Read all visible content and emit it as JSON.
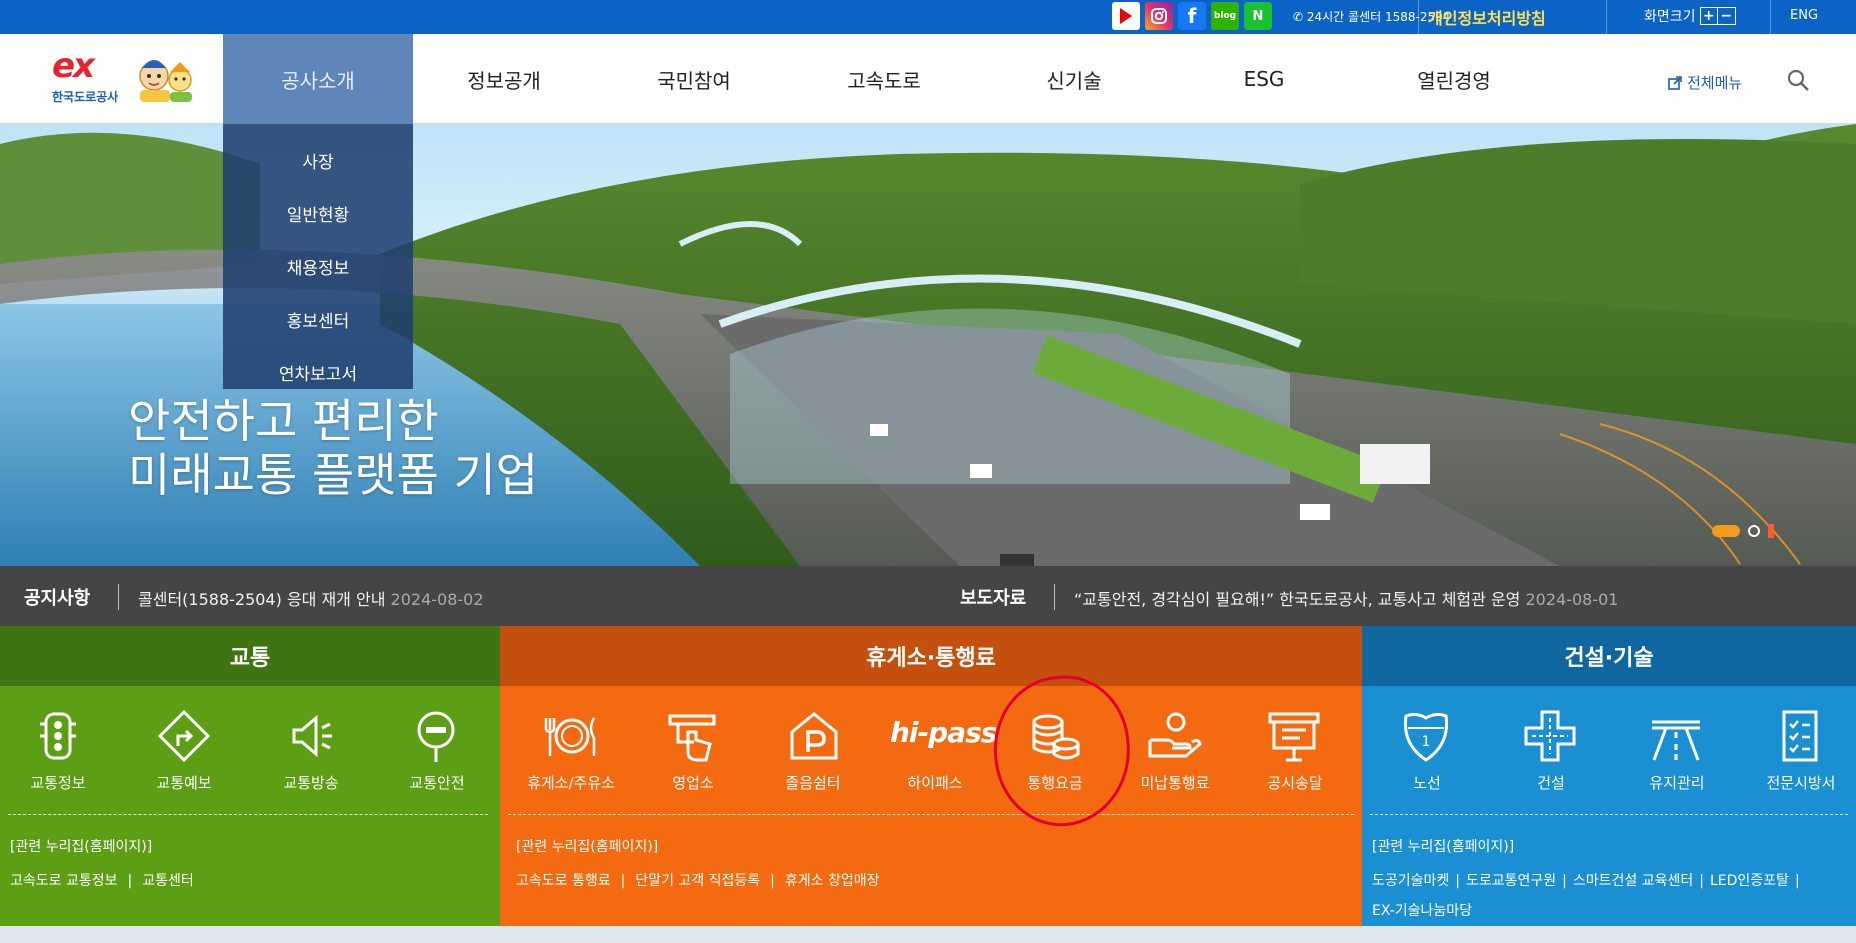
{
  "topbar": {
    "social": [
      "youtube-icon",
      "instagram-icon",
      "facebook-icon",
      "blog-icon",
      "naver-post-icon"
    ],
    "call_center": "24시간 콜센터 1588-2504",
    "privacy": "개인정보처리방침",
    "zoom_label": "화면크기",
    "zoom_plus": "+",
    "zoom_minus": "−",
    "eng": "ENG"
  },
  "header": {
    "logo_ex": "ex",
    "logo_name": "한국도로공사",
    "nav": [
      "공사소개",
      "정보공개",
      "국민참여",
      "고속도로",
      "신기술",
      "ESG",
      "열린경영"
    ],
    "active_index": 0,
    "full_menu": "전체메뉴"
  },
  "dropdown": [
    "사장",
    "일반현황",
    "채용정보",
    "홍보센터",
    "연차보고서"
  ],
  "hero": {
    "line1": "안전하고 편리한",
    "line2": "미래교통 플랫폼 기업"
  },
  "notice": {
    "label": "공지사항",
    "text": "콜센터(1588-2504) 응대 재개 안내",
    "date": "2024-08-02",
    "press_label": "보도자료",
    "press_text": "“교통안전, 경각심이 필요해!” 한국도로공사, 교통사고 체험관 운영",
    "press_date": "2024-08-01"
  },
  "panels": {
    "traffic": {
      "title": "교통",
      "items": [
        "교통정보",
        "교통예보",
        "교통방송",
        "교통안전"
      ],
      "related": "[관련 누리집(홈페이지)]",
      "links": [
        "고속도로 교통정보",
        "교통센터"
      ]
    },
    "rest": {
      "title": "휴게소·통행료",
      "items": [
        "휴게소/주유소",
        "영업소",
        "졸음쉼터",
        "하이패스",
        "통행요금",
        "미납통행료",
        "공시송달"
      ],
      "hipass_logo": "hi-pass",
      "related": "[관련 누리집(홈페이지)]",
      "links": [
        "고속도로 통행료",
        "단말기 고객 직접등록",
        "휴게소 창업매장"
      ]
    },
    "construction": {
      "title": "건설·기술",
      "items": [
        "노선",
        "건설",
        "유지관리",
        "전문시방서"
      ],
      "related": "[관련 누리집(홈페이지)]",
      "links": [
        "도공기술마켓",
        "도로교통연구원",
        "스마트건설 교육센터",
        "LED인증포탈",
        "EX-기술나눔마당"
      ]
    }
  },
  "colors": {
    "topbar": "#0b63c5",
    "traffic": "#5c9e14",
    "rest": "#f36a10",
    "construction": "#1a8fd2",
    "annotation": "#e4002b"
  }
}
